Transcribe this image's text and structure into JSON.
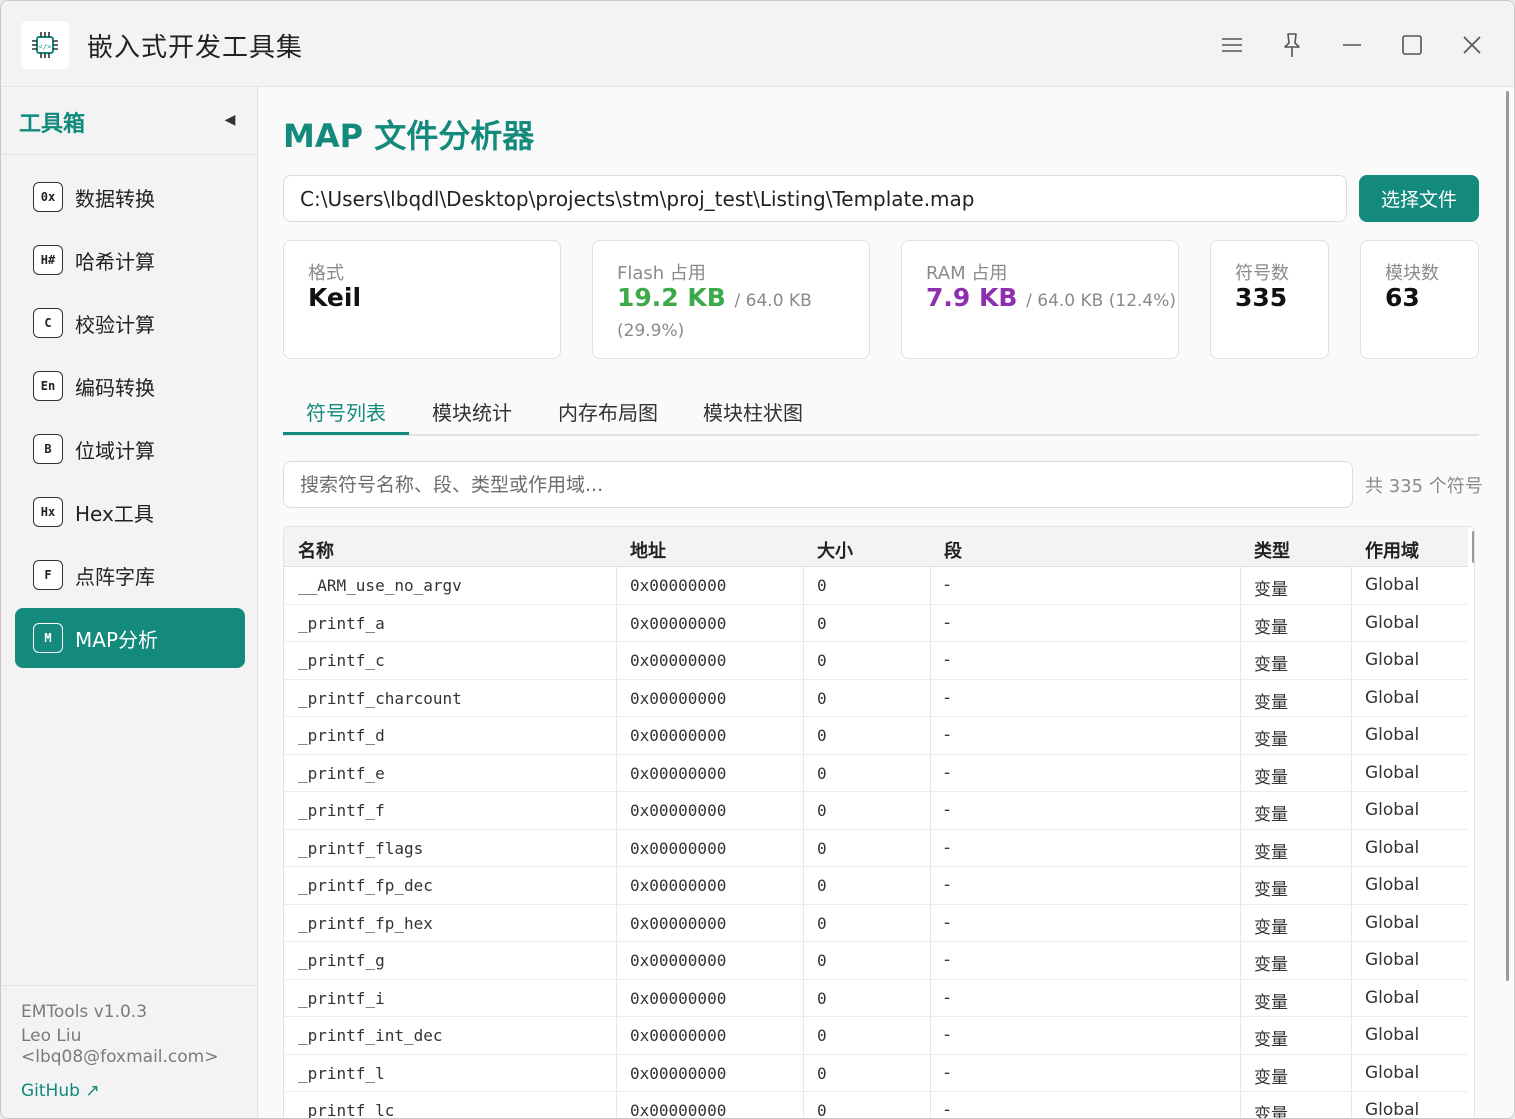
{
  "app": {
    "title": "嵌入式开发工具集"
  },
  "sidebar": {
    "title": "工具箱",
    "items": [
      {
        "icon": "0x",
        "label": "数据转换"
      },
      {
        "icon": "H#",
        "label": "哈希计算"
      },
      {
        "icon": "C",
        "label": "校验计算"
      },
      {
        "icon": "En",
        "label": "编码转换"
      },
      {
        "icon": "B",
        "label": "位域计算"
      },
      {
        "icon": "Hx",
        "label": "Hex工具"
      },
      {
        "icon": "F",
        "label": "点阵字库"
      },
      {
        "icon": "M",
        "label": "MAP分析"
      }
    ],
    "active_index": 7,
    "footer": {
      "version": "EMTools v1.0.3",
      "author": "Leo Liu",
      "email": "<lbq08@foxmail.com>",
      "link": "GitHub ↗"
    }
  },
  "main": {
    "title": "MAP 文件分析器",
    "file_path": "C:\\Users\\lbqdl\\Desktop\\projects\\stm\\proj_test\\Listing\\Template.map",
    "select_button": "选择文件",
    "cards": {
      "format": {
        "label": "格式",
        "value": "Keil"
      },
      "flash": {
        "label": "Flash 占用",
        "value": "19.2 KB",
        "total": "/ 64.0 KB",
        "percent": "(29.9%)",
        "color": "#3daa4a"
      },
      "ram": {
        "label": "RAM 占用",
        "value": "7.9 KB",
        "total": "/ 64.0 KB (12.4%)",
        "color": "#8e2fb0"
      },
      "symbols": {
        "label": "符号数",
        "value": "335"
      },
      "modules": {
        "label": "模块数",
        "value": "63"
      }
    },
    "tabs": [
      "符号列表",
      "模块统计",
      "内存布局图",
      "模块柱状图"
    ],
    "active_tab": 0,
    "search": {
      "placeholder": "搜索符号名称、段、类型或作用域..."
    },
    "count_text": "共 335 个符号",
    "table": {
      "headers": [
        "名称",
        "地址",
        "大小",
        "段",
        "类型",
        "作用域"
      ],
      "rows": [
        [
          "__ARM_use_no_argv",
          "0x00000000",
          "0",
          "-",
          "变量",
          "Global"
        ],
        [
          "_printf_a",
          "0x00000000",
          "0",
          "-",
          "变量",
          "Global"
        ],
        [
          "_printf_c",
          "0x00000000",
          "0",
          "-",
          "变量",
          "Global"
        ],
        [
          "_printf_charcount",
          "0x00000000",
          "0",
          "-",
          "变量",
          "Global"
        ],
        [
          "_printf_d",
          "0x00000000",
          "0",
          "-",
          "变量",
          "Global"
        ],
        [
          "_printf_e",
          "0x00000000",
          "0",
          "-",
          "变量",
          "Global"
        ],
        [
          "_printf_f",
          "0x00000000",
          "0",
          "-",
          "变量",
          "Global"
        ],
        [
          "_printf_flags",
          "0x00000000",
          "0",
          "-",
          "变量",
          "Global"
        ],
        [
          "_printf_fp_dec",
          "0x00000000",
          "0",
          "-",
          "变量",
          "Global"
        ],
        [
          "_printf_fp_hex",
          "0x00000000",
          "0",
          "-",
          "变量",
          "Global"
        ],
        [
          "_printf_g",
          "0x00000000",
          "0",
          "-",
          "变量",
          "Global"
        ],
        [
          "_printf_i",
          "0x00000000",
          "0",
          "-",
          "变量",
          "Global"
        ],
        [
          "_printf_int_dec",
          "0x00000000",
          "0",
          "-",
          "变量",
          "Global"
        ],
        [
          "_printf_l",
          "0x00000000",
          "0",
          "-",
          "变量",
          "Global"
        ],
        [
          "_printf_lc",
          "0x00000000",
          "0",
          "-",
          "变量",
          "Global"
        ]
      ]
    }
  },
  "colors": {
    "accent": "#138a7c"
  }
}
